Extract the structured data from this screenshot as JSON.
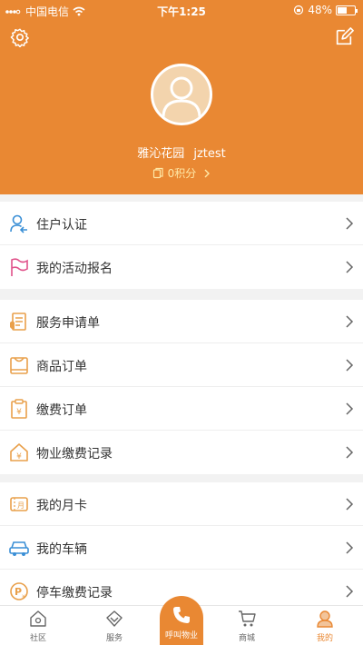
{
  "status_bar": {
    "carrier": "中国电信",
    "time": "下午1:25",
    "battery": "48%"
  },
  "profile": {
    "community": "雅沁花园",
    "username": "jztest",
    "points": "0积分"
  },
  "menu_groups": [
    [
      {
        "label": "住户认证",
        "icon": "resident-auth-icon"
      },
      {
        "label": "我的活动报名",
        "icon": "flag-icon"
      }
    ],
    [
      {
        "label": "服务申请单",
        "icon": "service-form-icon"
      },
      {
        "label": "商品订单",
        "icon": "bag-icon"
      },
      {
        "label": "缴费订单",
        "icon": "payment-order-icon"
      },
      {
        "label": "物业缴费记录",
        "icon": "house-payment-icon"
      }
    ],
    [
      {
        "label": "我的月卡",
        "icon": "month-card-icon"
      },
      {
        "label": "我的车辆",
        "icon": "car-icon"
      },
      {
        "label": "停车缴费记录",
        "icon": "parking-icon"
      }
    ]
  ],
  "tabbar": {
    "community": "社区",
    "service": "服务",
    "call": "呼叫物业",
    "mall": "商城",
    "mine": "我的"
  },
  "colors": {
    "accent": "#e98833",
    "points": "#ffe9a8"
  }
}
